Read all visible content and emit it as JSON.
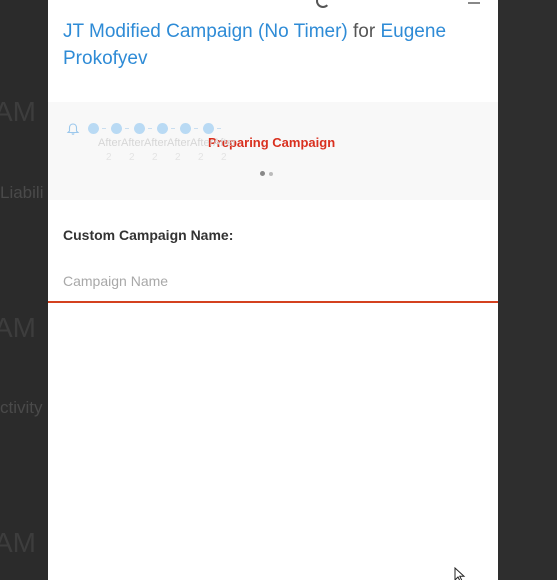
{
  "background": {
    "fragments": [
      {
        "text": "AM",
        "size": "big"
      },
      {
        "text": "Liabili",
        "size": "small"
      },
      {
        "text": "AM",
        "size": "big"
      },
      {
        "text": "ctivity",
        "size": "small"
      },
      {
        "text": "AM",
        "size": "big"
      }
    ]
  },
  "modal": {
    "title": {
      "campaign": "JT Modified Campaign (No Timer)",
      "connector": "for",
      "contact": "Eugene Prokofyev"
    },
    "progress": {
      "steps": [
        {
          "label": "After",
          "sub": "2"
        },
        {
          "label": "After",
          "sub": "2"
        },
        {
          "label": "After",
          "sub": "2"
        },
        {
          "label": "After",
          "sub": "2"
        },
        {
          "label": "After",
          "sub": "2"
        },
        {
          "label": "After",
          "sub": "2"
        }
      ],
      "status": "Preparing Campaign",
      "status_color": "#d9301f",
      "pager_total": 2,
      "pager_active": 1
    },
    "form": {
      "label": "Custom Campaign Name:",
      "input_value": "",
      "input_placeholder": "Campaign Name"
    }
  },
  "colors": {
    "link": "#2e8bd6",
    "error_underline": "#d4411f",
    "step_dot": "#b9daf4"
  }
}
